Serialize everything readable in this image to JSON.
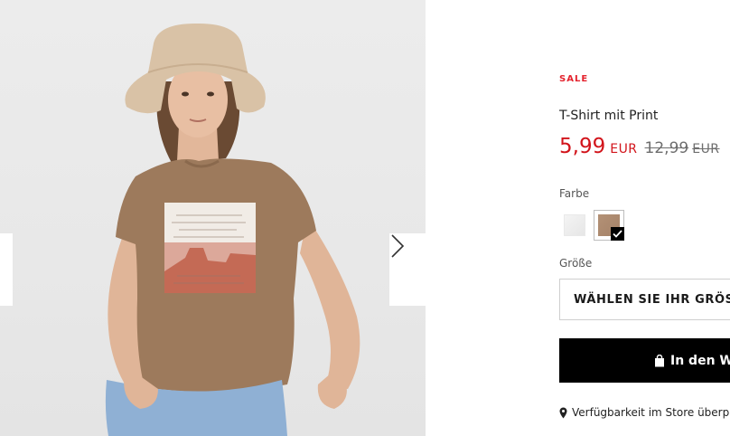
{
  "gallery": {
    "image_alt": "T-Shirt mit Print",
    "prev_icon": "chevron-left-icon",
    "next_icon": "chevron-right-icon"
  },
  "product": {
    "sale_badge": "SALE",
    "title": "T-Shirt mit Print",
    "price_current": "5,99",
    "price_current_currency": "EUR",
    "price_old": "12,99",
    "price_old_currency": "EUR",
    "colors": {
      "sale": "#e4232e",
      "price": "#d2141b",
      "cart_button_bg": "#000000"
    }
  },
  "color_picker": {
    "label": "Farbe",
    "options": [
      {
        "name": "white",
        "swatch": "#eeeeee",
        "selected": false
      },
      {
        "name": "brown",
        "swatch": "#ab8a6f",
        "selected": true
      }
    ],
    "selected_icon": "check-icon"
  },
  "size_picker": {
    "label": "Größe",
    "placeholder": "WÄHLEN SIE IHR GRÖSS"
  },
  "cart": {
    "label": "In den W",
    "icon": "shopping-bag-icon"
  },
  "store": {
    "label": "Verfügbarkeit im Store überp",
    "icon": "map-pin-icon"
  }
}
